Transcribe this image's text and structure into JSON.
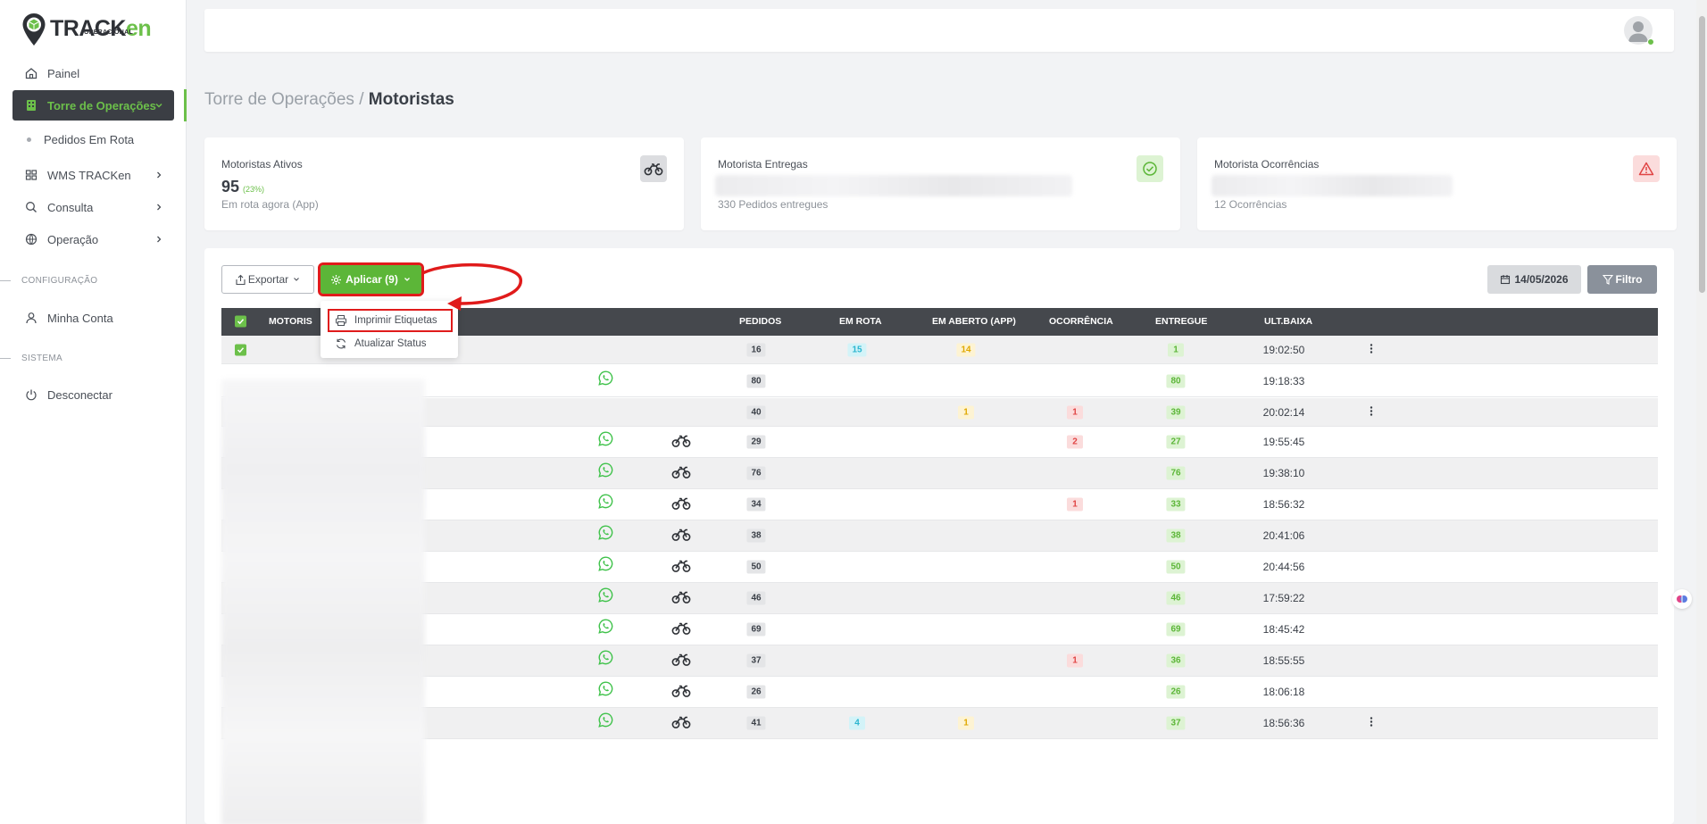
{
  "brand": {
    "name_a": "TRACK",
    "name_b": "en",
    "subtitle": "OPERACIONAL",
    "accent": "#6cc04a"
  },
  "sidebar": {
    "items": [
      {
        "label": "Painel",
        "icon": "home-icon"
      },
      {
        "label": "Torre de Operações",
        "icon": "building-icon",
        "active": true
      },
      {
        "label": "Pedidos Em Rota",
        "sub": true
      },
      {
        "label": "WMS TRACKen",
        "icon": "grid-icon"
      },
      {
        "label": "Consulta",
        "icon": "search-icon"
      },
      {
        "label": "Operação",
        "icon": "globe-icon"
      }
    ],
    "section_config": "CONFIGURAÇÃO",
    "account": "Minha Conta",
    "section_system": "SISTEMA",
    "logout": "Desconectar"
  },
  "breadcrumb": {
    "parent": "Torre de Operações /",
    "current": "Motoristas"
  },
  "cards": {
    "active": {
      "title": "Motoristas Ativos",
      "value": "95",
      "percent": "(23%)",
      "sub": "Em rota agora (App)"
    },
    "deliveries": {
      "title": "Motorista Entregas",
      "sub": "330 Pedidos entregues"
    },
    "occurrences": {
      "title": "Motorista Ocorrências",
      "sub": "12 Ocorrências"
    }
  },
  "toolbar": {
    "export": "Exportar",
    "apply": "Aplicar (9)",
    "date": "14/05/2026",
    "filter": "Filtro"
  },
  "dropdown": {
    "print": "Imprimir Etiquetas",
    "update": "Atualizar Status"
  },
  "table": {
    "headers": {
      "driver": "MOTORIS",
      "orders": "PEDIDOS",
      "in_route": "EM ROTA",
      "open_app": "EM ABERTO (APP)",
      "occurrence": "OCORRÊNCIA",
      "delivered": "ENTREGUE",
      "last": "ULT.BAIXA"
    },
    "rows": [
      {
        "checked": true,
        "whatsapp": false,
        "bike": false,
        "orders": "16",
        "in_route": "15",
        "open": "14",
        "occ": "",
        "delivered": "1",
        "time": "19:02:50",
        "menu": true
      },
      {
        "checked": false,
        "whatsapp": true,
        "bike": false,
        "orders": "80",
        "in_route": "",
        "open": "",
        "occ": "",
        "delivered": "80",
        "time": "19:18:33",
        "menu": false
      },
      {
        "checked": true,
        "whatsapp": false,
        "bike": false,
        "orders": "40",
        "in_route": "",
        "open": "1",
        "occ": "1",
        "delivered": "39",
        "time": "20:02:14",
        "menu": true
      },
      {
        "checked": false,
        "whatsapp": true,
        "bike": true,
        "orders": "29",
        "in_route": "",
        "open": "",
        "occ": "2",
        "delivered": "27",
        "time": "19:55:45",
        "menu": false
      },
      {
        "checked": false,
        "whatsapp": true,
        "bike": true,
        "orders": "76",
        "in_route": "",
        "open": "",
        "occ": "",
        "delivered": "76",
        "time": "19:38:10",
        "menu": false
      },
      {
        "checked": false,
        "whatsapp": true,
        "bike": true,
        "orders": "34",
        "in_route": "",
        "open": "",
        "occ": "1",
        "delivered": "33",
        "time": "18:56:32",
        "menu": false
      },
      {
        "checked": false,
        "whatsapp": true,
        "bike": true,
        "orders": "38",
        "in_route": "",
        "open": "",
        "occ": "",
        "delivered": "38",
        "time": "20:41:06",
        "menu": false
      },
      {
        "checked": false,
        "whatsapp": true,
        "bike": true,
        "orders": "50",
        "in_route": "",
        "open": "",
        "occ": "",
        "delivered": "50",
        "time": "20:44:56",
        "menu": false
      },
      {
        "checked": false,
        "whatsapp": true,
        "bike": true,
        "orders": "46",
        "in_route": "",
        "open": "",
        "occ": "",
        "delivered": "46",
        "time": "17:59:22",
        "menu": false
      },
      {
        "checked": false,
        "whatsapp": true,
        "bike": true,
        "orders": "69",
        "in_route": "",
        "open": "",
        "occ": "",
        "delivered": "69",
        "time": "18:45:42",
        "menu": false
      },
      {
        "checked": false,
        "whatsapp": true,
        "bike": true,
        "orders": "37",
        "in_route": "",
        "open": "",
        "occ": "1",
        "delivered": "36",
        "time": "18:55:55",
        "menu": false
      },
      {
        "checked": false,
        "whatsapp": true,
        "bike": true,
        "orders": "26",
        "in_route": "",
        "open": "",
        "occ": "",
        "delivered": "26",
        "time": "18:06:18",
        "menu": false
      },
      {
        "checked": true,
        "whatsapp": true,
        "bike": true,
        "orders": "41",
        "in_route": "4",
        "open": "1",
        "occ": "",
        "delivered": "37",
        "time": "18:56:36",
        "menu": true
      }
    ]
  }
}
